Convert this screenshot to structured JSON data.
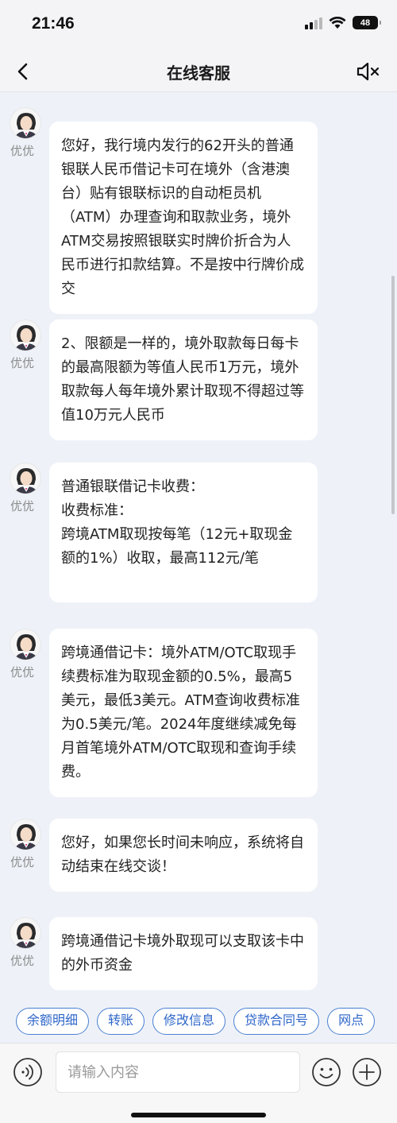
{
  "status_bar": {
    "time": "21:46",
    "battery": "48"
  },
  "header": {
    "title": "在线客服"
  },
  "agent": {
    "name": "优优"
  },
  "messages": [
    {
      "text": "您好，我行境内发行的62开头的普通银联人民币借记卡可在境外（含港澳台）贴有银联标识的自动柜员机（ATM）办理查询和取款业务，境外ATM交易按照银联实时牌价折合为人民币进行扣款结算。不是按中行牌价成交"
    },
    {
      "text": "2、限额是一样的，境外取款每日每卡的最高限额为等值人民币1万元，境外取款每人每年境外累计取现不得超过等值10万元人民币"
    },
    {
      "text": "普通银联借记卡收费：\n收费标准：\n跨境ATM取现按每笔（12元+取现金额的1%）收取，最高112元/笔"
    },
    {
      "text": "跨境通借记卡：境外ATM/OTC取现手续费标准为取现金额的0.5%，最高5美元，最低3美元。ATM查询收费标准为0.5美元/笔。2024年度继续减免每月首笔境外ATM/OTC取现和查询手续费。"
    },
    {
      "text": "您好，如果您长时间未响应，系统将自动结束在线交谈！"
    },
    {
      "text": "跨境通借记卡境外取现可以支取该卡中的外币资金"
    }
  ],
  "quick_replies": [
    "余额明细",
    "转账",
    "修改信息",
    "贷款合同号",
    "网点"
  ],
  "input": {
    "placeholder": "请输入内容"
  },
  "colors": {
    "accent": "#2e66c9",
    "background": "#eef2f8",
    "bubble": "#ffffff"
  }
}
